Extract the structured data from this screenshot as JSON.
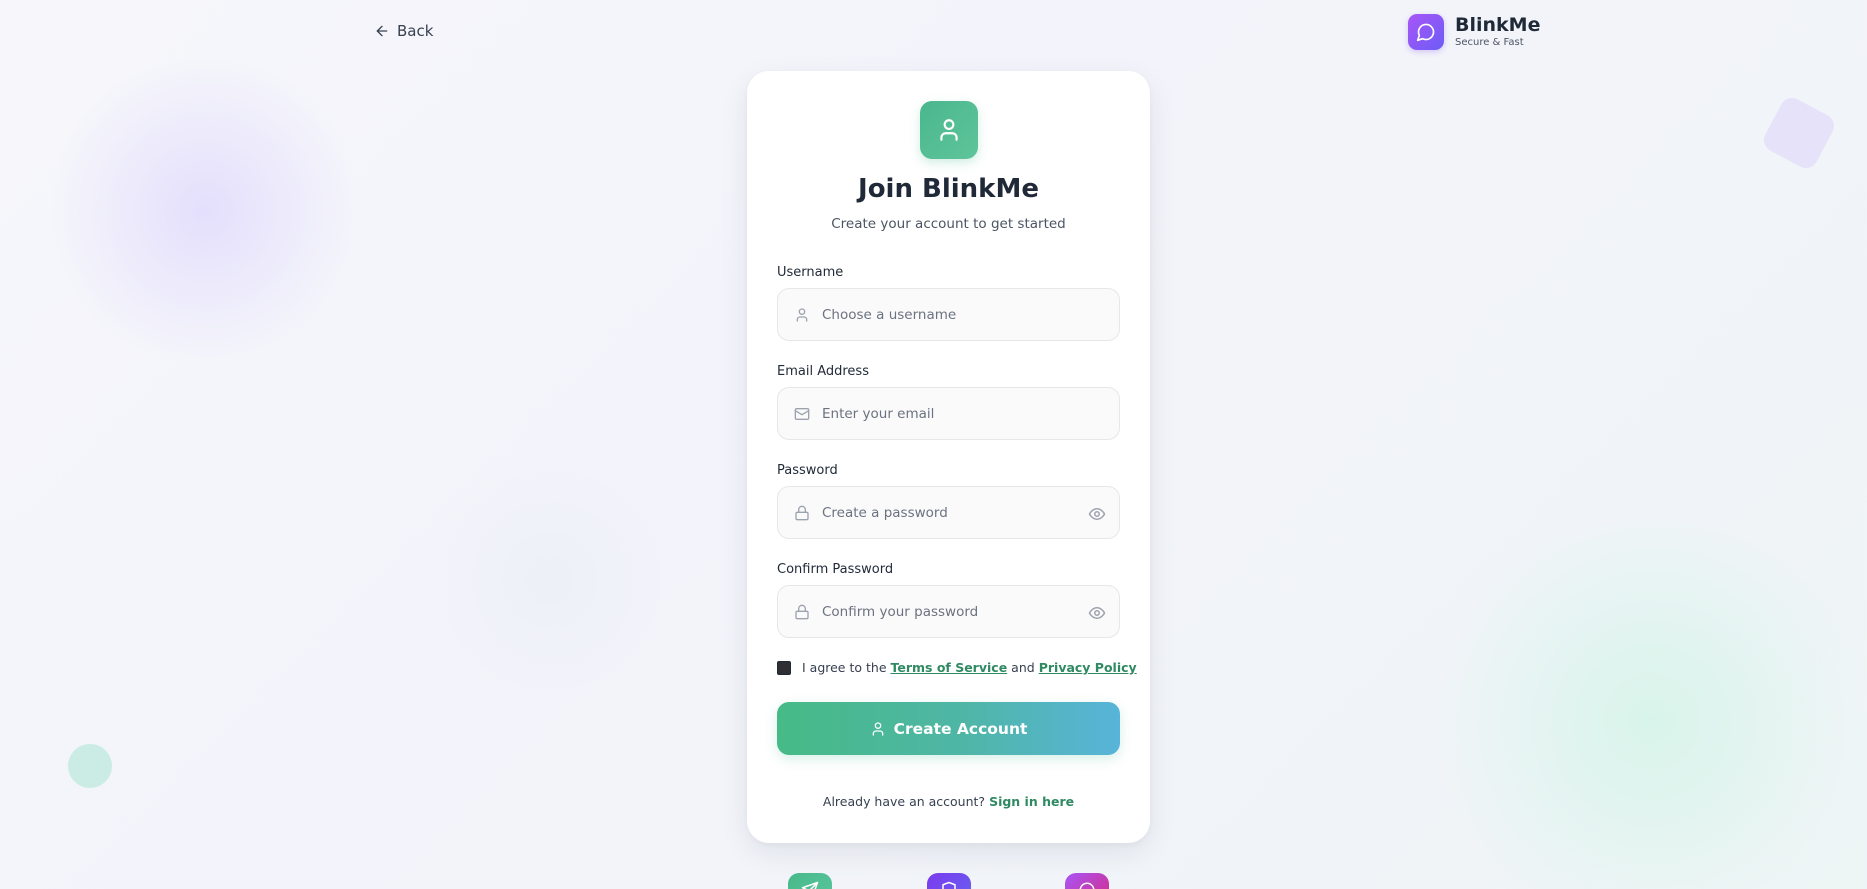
{
  "nav": {
    "back_label": "Back"
  },
  "brand": {
    "name": "BlinkMe",
    "tagline": "Secure & Fast"
  },
  "card": {
    "title": "Join BlinkMe",
    "subtitle": "Create your account to get started"
  },
  "form": {
    "username": {
      "label": "Username",
      "placeholder": "Choose a username",
      "value": ""
    },
    "email": {
      "label": "Email Address",
      "placeholder": "Enter your email",
      "value": ""
    },
    "password": {
      "label": "Password",
      "placeholder": "Create a password",
      "value": ""
    },
    "confirm_password": {
      "label": "Confirm Password",
      "placeholder": "Confirm your password",
      "value": ""
    },
    "terms": {
      "prefix": "I agree to the",
      "terms_link": "Terms of Service",
      "and": "and",
      "privacy_link": "Privacy Policy",
      "checked": false
    },
    "submit_label": "Create Account"
  },
  "footer": {
    "prompt": "Already have an account?",
    "signin_link": "Sign in here"
  },
  "icons": {
    "back": "arrow-left-icon",
    "brand": "message-circle-icon",
    "card": "user-icon",
    "username": "user-icon",
    "email": "mail-icon",
    "password": "lock-icon",
    "toggle": "eye-icon",
    "features": [
      "send-icon",
      "shield-icon",
      "message-icon"
    ]
  },
  "colors": {
    "primary_green": "#46ba86",
    "gradient_end_blue": "#58b4d9",
    "brand_purple": "#8b5cf6",
    "link_green": "#2f8a61"
  }
}
